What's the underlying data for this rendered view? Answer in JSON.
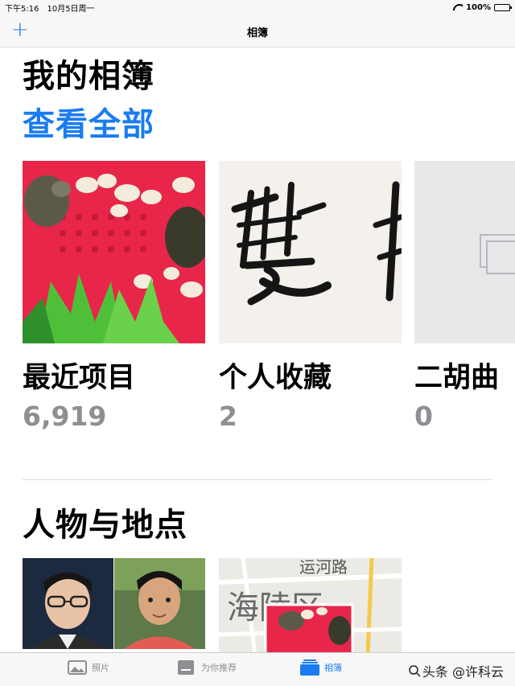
{
  "status_bar": {
    "time": "下午5:16",
    "date": "10月5日周一",
    "battery": "100%"
  },
  "nav": {
    "title": "相簿",
    "add_icon": "plus-icon"
  },
  "my_albums": {
    "title": "我的相簿",
    "see_all": "查看全部",
    "albums": [
      {
        "name": "最近项目",
        "count": "6,919"
      },
      {
        "name": "个人收藏",
        "count": "2"
      },
      {
        "name": "二胡曲",
        "count": "0"
      }
    ]
  },
  "people_places": {
    "title": "人物与地点"
  },
  "tab_bar": {
    "tabs": [
      {
        "label": "照片",
        "icon": "photos-icon"
      },
      {
        "label": "为你推荐",
        "icon": "for-you-icon"
      },
      {
        "label": "相簿",
        "icon": "albums-icon"
      }
    ],
    "watermark": "头条 @许科云"
  },
  "colors": {
    "accent": "#1a7cf0",
    "secondary_text": "#8e8e93"
  }
}
